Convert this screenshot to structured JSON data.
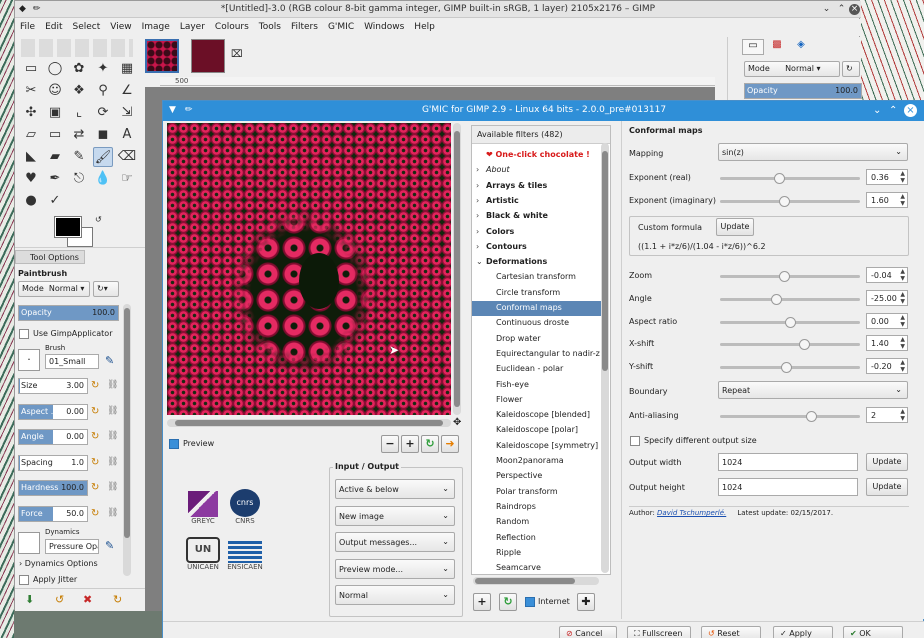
{
  "gimp": {
    "window_title": "*[Untitled]-3.0 (RGB colour 8-bit gamma integer, GIMP built-in sRGB, 1 layer) 2105x2176 – GIMP",
    "menu": [
      "File",
      "Edit",
      "Select",
      "View",
      "Image",
      "Layer",
      "Colours",
      "Tools",
      "Filters",
      "G'MIC",
      "Windows",
      "Help"
    ],
    "ruler_label": "500",
    "tool_options": {
      "tab_label": "Tool Options",
      "tool_name": "Paintbrush",
      "mode_label": "Mode",
      "mode_value": "Normal",
      "opacity_label": "Opacity",
      "opacity_value": "100.0",
      "opacity_fraction": 1.0,
      "use_applicator": "Use GimpApplicator",
      "brush_label": "Brush",
      "brush_value": "01_Small",
      "sliders": [
        {
          "label": "Size",
          "value": "3.00",
          "fraction": 0.02
        },
        {
          "label": "Aspect ...",
          "value": "0.00",
          "fraction": 0.5
        },
        {
          "label": "Angle",
          "value": "0.00",
          "fraction": 0.5
        },
        {
          "label": "Spacing",
          "value": "1.0",
          "fraction": 0.01
        },
        {
          "label": "Hardness",
          "value": "100.0",
          "fraction": 1.0
        },
        {
          "label": "Force",
          "value": "50.0",
          "fraction": 0.5
        }
      ],
      "dynamics_label": "Dynamics",
      "dynamics_value": "Pressure Opac",
      "dynamics_options": "Dynamics Options",
      "apply_jitter": "Apply Jitter"
    },
    "right_dock": {
      "mode_label": "Mode",
      "mode_value": "Normal",
      "opacity_label": "Opacity",
      "opacity_value": "100.0"
    }
  },
  "gmic": {
    "title": "G'MIC for GIMP 2.9 - Linux 64 bits - 2.0.0_pre#013117",
    "preview_label": "Preview",
    "io_title": "Input / Output",
    "io_combos": [
      "Active & below",
      "New image",
      "Output messages...",
      "Preview mode...",
      "Normal"
    ],
    "logos": [
      "GREYC",
      "CNRS",
      "UNICAEN",
      "ENSICAEN"
    ],
    "filters_header": "Available filters (482)",
    "filter_rows": [
      {
        "label": "❤ One-click chocolate !",
        "kind": "special"
      },
      {
        "label": "About",
        "kind": "italic-folder"
      },
      {
        "label": "Arrays & tiles",
        "kind": "folder"
      },
      {
        "label": "Artistic",
        "kind": "folder"
      },
      {
        "label": "Black & white",
        "kind": "folder"
      },
      {
        "label": "Colors",
        "kind": "folder"
      },
      {
        "label": "Contours",
        "kind": "folder"
      },
      {
        "label": "Deformations",
        "kind": "open-folder"
      },
      {
        "label": "Cartesian transform",
        "kind": "item"
      },
      {
        "label": "Circle transform",
        "kind": "item"
      },
      {
        "label": "Conformal maps",
        "kind": "selected"
      },
      {
        "label": "Continuous droste",
        "kind": "item"
      },
      {
        "label": "Drop water",
        "kind": "item"
      },
      {
        "label": "Equirectangular to nadir-z",
        "kind": "item"
      },
      {
        "label": "Euclidean - polar",
        "kind": "item"
      },
      {
        "label": "Fish-eye",
        "kind": "item"
      },
      {
        "label": "Flower",
        "kind": "item"
      },
      {
        "label": "Kaleidoscope [blended]",
        "kind": "item"
      },
      {
        "label": "Kaleidoscope [polar]",
        "kind": "item"
      },
      {
        "label": "Kaleidoscope [symmetry]",
        "kind": "item"
      },
      {
        "label": "Moon2panorama",
        "kind": "item"
      },
      {
        "label": "Perspective",
        "kind": "item"
      },
      {
        "label": "Polar transform",
        "kind": "item"
      },
      {
        "label": "Raindrops",
        "kind": "item"
      },
      {
        "label": "Random",
        "kind": "item"
      },
      {
        "label": "Reflection",
        "kind": "item"
      },
      {
        "label": "Ripple",
        "kind": "item"
      },
      {
        "label": "Seamcarve",
        "kind": "item"
      }
    ],
    "internet_label": "Internet",
    "params": {
      "section_title": "Conformal maps",
      "mapping_label": "Mapping",
      "mapping_value": "sin(z)",
      "exponent_real_label": "Exponent (real)",
      "exponent_real_value": "0.36",
      "exponent_real_fraction": 0.42,
      "exponent_imag_label": "Exponent (imaginary)",
      "exponent_imag_value": "1.60",
      "exponent_imag_fraction": 0.46,
      "custom_formula_label": "Custom formula",
      "update_label": "Update",
      "custom_formula_value": "((1.1 + i*z/6)/(1.04 - i*z/6))^6.2",
      "zoom_label": "Zoom",
      "zoom_value": "-0.04",
      "zoom_fraction": 0.46,
      "angle_label": "Angle",
      "angle_value": "-25.00",
      "angle_fraction": 0.4,
      "aspect_label": "Aspect ratio",
      "aspect_value": "0.00",
      "aspect_fraction": 0.5,
      "xshift_label": "X-shift",
      "xshift_value": "1.40",
      "xshift_fraction": 0.6,
      "yshift_label": "Y-shift",
      "yshift_value": "-0.20",
      "yshift_fraction": 0.47,
      "boundary_label": "Boundary",
      "boundary_value": "Repeat",
      "antialias_label": "Anti-aliasing",
      "antialias_value": "2",
      "antialias_fraction": 0.65,
      "diff_output_label": "Specify different output size",
      "output_width_label": "Output width",
      "output_width_value": "1024",
      "output_height_label": "Output height",
      "output_height_value": "1024",
      "author_label": "Author:",
      "author_name": "David Tschumperlé.",
      "update_date": "Latest update: 02/15/2017."
    },
    "bottom_buttons": [
      "Cancel",
      "Fullscreen",
      "Reset",
      "Apply",
      "OK"
    ]
  }
}
